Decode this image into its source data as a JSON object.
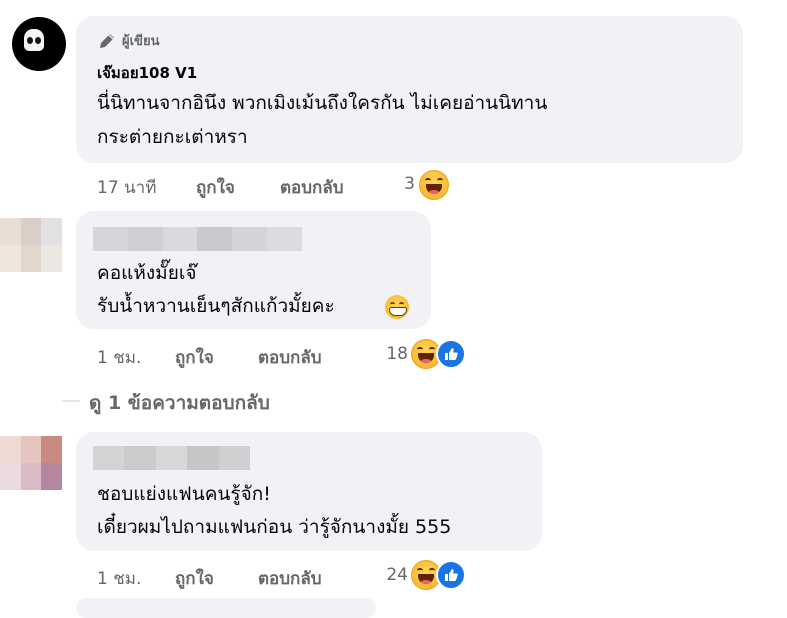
{
  "comments": [
    {
      "badge": "ผู้เขียน",
      "author": "เจ๊มอย108 V1",
      "lines": [
        "นี่นิทานจากอินึง พวกเมิงเม้นถึงใครกัน ไม่เคยอ่านนิทาน",
        "กระต่ายกะเต่าหรา"
      ],
      "time": "17 นาที",
      "like_label": "ถูกใจ",
      "reply_label": "ตอบกลับ",
      "reaction_count": "3",
      "reactions": [
        "haha-icon"
      ]
    },
    {
      "lines": [
        "คอแห้งมั๊ยเจ๊",
        "รับน้ำหวานเย็นๆสักแก้วมั้ยคะ"
      ],
      "inline_emoji": "grinning-face-icon",
      "time": "1 ชม.",
      "like_label": "ถูกใจ",
      "reply_label": "ตอบกลับ",
      "reaction_count": "18",
      "reactions": [
        "haha-icon",
        "like-icon"
      ]
    },
    {
      "lines": [
        "ชอบแย่งแฟนคนรู้จัก!",
        "เดี๋ยวผมไปถามแฟนก่อน ว่ารู้จักนางมั้ย 555"
      ],
      "time": "1 ชม.",
      "like_label": "ถูกใจ",
      "reply_label": "ตอบกลับ",
      "reaction_count": "24",
      "reactions": [
        "haha-icon",
        "like-icon"
      ]
    }
  ],
  "view_replies": "ดู 1 ข้อความตอบกลับ",
  "colors": {
    "bubble": "#f0f2f5",
    "meta_text": "#65676b",
    "like_blue": "#1b74e4"
  }
}
